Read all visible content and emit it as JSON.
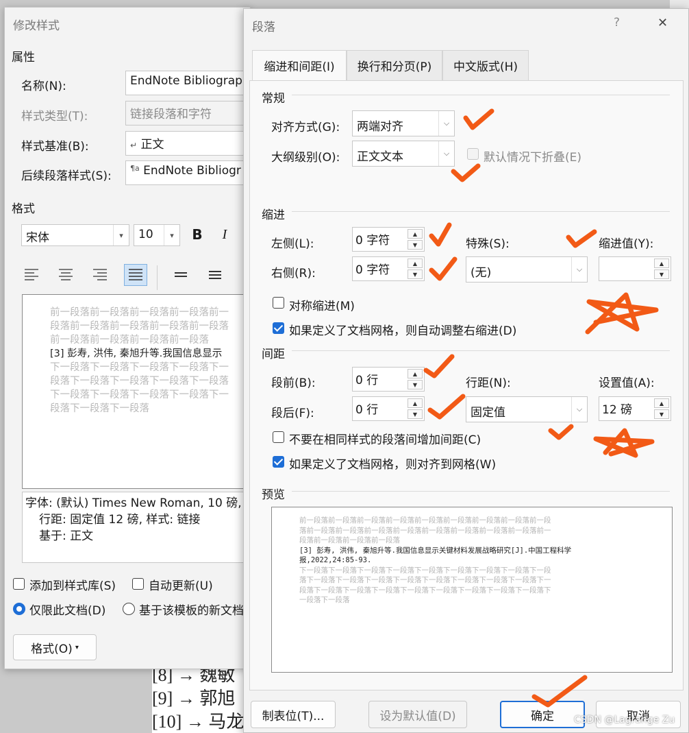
{
  "background_doc": {
    "lines": [
      "[8] → 魏敏",
      "[9] → 郭旭",
      "[10] → 马龙"
    ]
  },
  "watermark": "CSDN @Lagrange Zu",
  "modify_style": {
    "title": "修改样式",
    "properties_label": "属性",
    "name_label": "名称(N):",
    "name_value": "EndNote Bibliograp",
    "style_type_label": "样式类型(T):",
    "style_type_value": "链接段落和字符",
    "based_on_label": "样式基准(B):",
    "based_on_value": "正文",
    "following_label": "后续段落样式(S):",
    "following_value": "EndNote Bibliogr",
    "format_label": "格式",
    "font_name": "宋体",
    "font_size": "10",
    "bold": "B",
    "italic": "I",
    "preview": {
      "prev_lines": [
        "前一段落前一段落前一段落前一段落前一",
        "段落前一段落前一段落前一段落前一段落",
        "前一段落前一段落前一段落前一段落"
      ],
      "sample": "[3]  彭寿, 洪伟, 秦旭升等.我国信息显示",
      "next_lines": [
        "下一段落下一段落下一段落下一段落下一",
        "段落下一段落下一段落下一段落下一段落",
        "下一段落下一段落下一段落下一段落下一",
        "段落下一段落下一段落"
      ]
    },
    "desc_lines": [
      "字体: (默认) Times New Roman, 10 磅,",
      "行距: 固定值 12 磅, 样式: 链接",
      "基于: 正文"
    ],
    "add_to_gallery": "添加到样式库(S)",
    "auto_update": "自动更新(U)",
    "only_this_doc": "仅限此文档(D)",
    "new_docs_template": "基于该模板的新文档",
    "format_button": "格式(O)"
  },
  "paragraph": {
    "title": "段落",
    "help": "?",
    "close": "✕",
    "tabs": [
      "缩进和间距(I)",
      "换行和分页(P)",
      "中文版式(H)"
    ],
    "general": {
      "label": "常规",
      "alignment_label": "对齐方式(G):",
      "alignment_value": "两端对齐",
      "outline_label": "大纲级别(O):",
      "outline_value": "正文文本",
      "collapse_label": "默认情况下折叠(E)"
    },
    "indent": {
      "label": "缩进",
      "left_label": "左侧(L):",
      "left_value": "0 字符",
      "right_label": "右侧(R):",
      "right_value": "0 字符",
      "special_label": "特殊(S):",
      "special_value": "(无)",
      "by_label": "缩进值(Y):",
      "by_value": "",
      "mirror_label": "对称缩进(M)",
      "auto_adjust_label": "如果定义了文档网格，则自动调整右缩进(D)"
    },
    "spacing": {
      "label": "间距",
      "before_label": "段前(B):",
      "before_value": "0 行",
      "after_label": "段后(F):",
      "after_value": "0 行",
      "line_spacing_label": "行距(N):",
      "line_spacing_value": "固定值",
      "at_label": "设置值(A):",
      "at_value": "12 磅",
      "no_space_same_style": "不要在相同样式的段落间增加间距(C)",
      "snap_to_grid": "如果定义了文档网格，则对齐到网格(W)"
    },
    "preview": {
      "label": "预览",
      "prev_lines": [
        "前一段落前一段落前一段落前一段落前一段落前一段落前一段落前一段落前一段",
        "落前一段落前一段落前一段落前一段落前一段落前一段落前一段落前一段落前一",
        "段落前一段落前一段落前一段落"
      ],
      "sample_lines": [
        "[3] 彭寿, 洪伟, 秦旭升等.我国信息显示关键材料发展战略研究[J].中国工程科学",
        "报,2022,24:85-93."
      ],
      "next_lines": [
        "下一段落下一段落下一段落下一段落下一段落下一段落下一段落下一段落下一段",
        "落下一段落下一段落下一段落下一段落下一段落下一段落下一段落下一段落下一",
        "段落下一段落下一段落下一段落下一段落下一段落下一段落下一段落下一段落下",
        "一段落下一段落"
      ]
    },
    "buttons": {
      "tabs": "制表位(T)...",
      "set_default": "设为默认值(D)",
      "ok": "确定",
      "cancel": "取消"
    }
  },
  "colors": {
    "accent": "#1e6ed6",
    "annotation": "#f25a16"
  }
}
